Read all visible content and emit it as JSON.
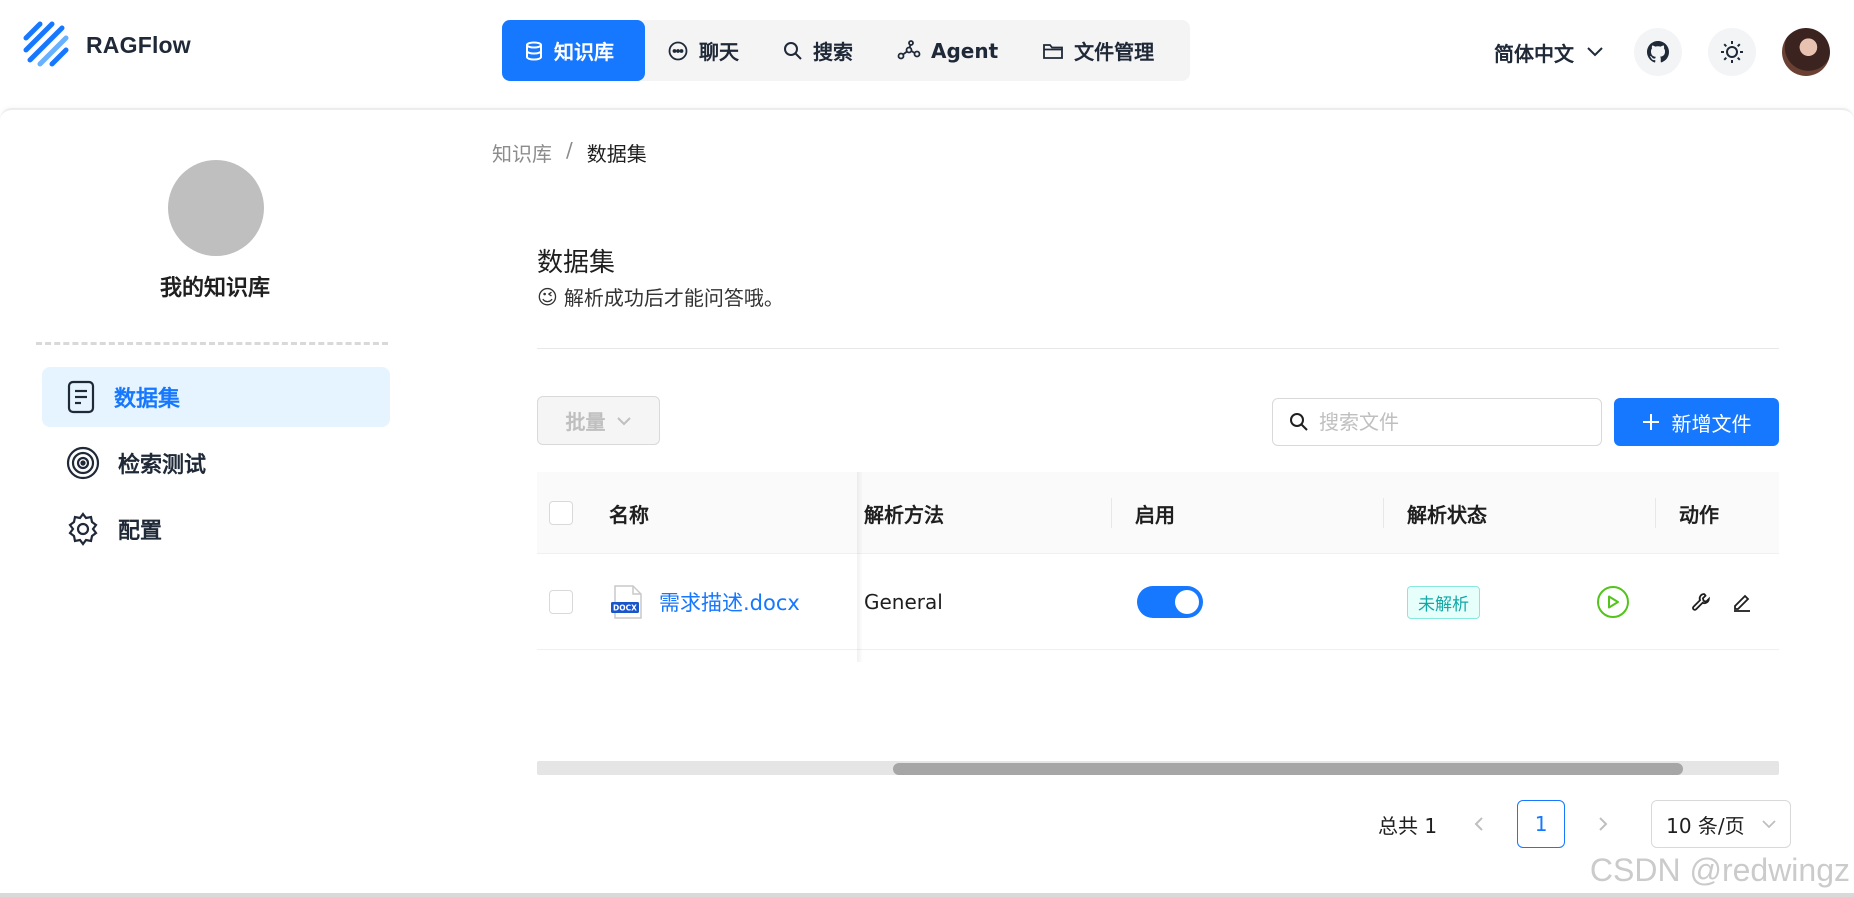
{
  "app": {
    "name": "RAGFlow"
  },
  "nav": {
    "items": [
      {
        "label": "知识库",
        "icon": "database-icon",
        "active": true
      },
      {
        "label": "聊天",
        "icon": "chat-icon",
        "active": false
      },
      {
        "label": "搜索",
        "icon": "search-icon",
        "active": false
      },
      {
        "label": "Agent",
        "icon": "agent-graph-icon",
        "active": false
      },
      {
        "label": "文件管理",
        "icon": "folder-icon",
        "active": false
      }
    ]
  },
  "header": {
    "language": "简体中文"
  },
  "sidebar": {
    "kb_name": "我的知识库",
    "items": [
      {
        "label": "数据集",
        "icon": "document-icon",
        "active": true
      },
      {
        "label": "检索测试",
        "icon": "target-icon",
        "active": false
      },
      {
        "label": "配置",
        "icon": "gear-icon",
        "active": false
      }
    ]
  },
  "breadcrumb": {
    "root": "知识库",
    "separator": "/",
    "current": "数据集"
  },
  "main": {
    "title": "数据集",
    "subtitle": "解析成功后才能问答哦。",
    "subtitle_emoji": "😉"
  },
  "toolbar": {
    "bulk_label": "批量",
    "search_placeholder": "搜索文件",
    "add_label": "新增文件"
  },
  "table": {
    "columns": [
      "名称",
      "解析方法",
      "启用",
      "解析状态",
      "动作"
    ],
    "rows": [
      {
        "file_type": "DOCX",
        "name": "需求描述.docx",
        "method": "General",
        "enabled": true,
        "status": "未解析"
      }
    ]
  },
  "pagination": {
    "total_label": "总共 1",
    "current_page": "1",
    "prev": "<",
    "next": ">",
    "page_size": "10 条/页"
  },
  "watermark": "CSDN @redwingz",
  "colors": {
    "primary": "#1677ff",
    "status_tag": "#13a8a8",
    "run": "#52c41a"
  }
}
